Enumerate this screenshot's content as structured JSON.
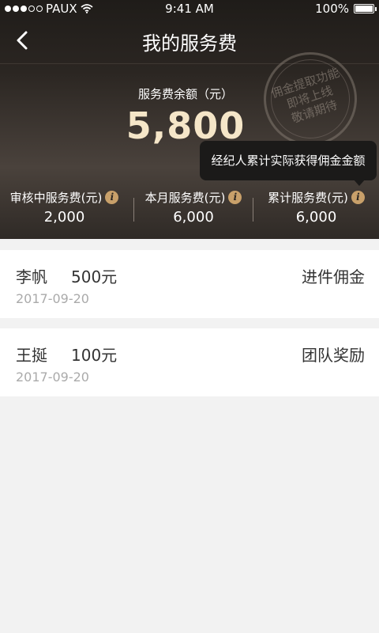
{
  "status_bar": {
    "carrier": "PAUX",
    "time": "9:41 AM",
    "battery": "100%",
    "battery_level": 1.0
  },
  "nav": {
    "title": "我的服务费",
    "back_icon": "chevron-left-icon"
  },
  "balance": {
    "label": "服务费余额（元）",
    "value": "5,800"
  },
  "stamp": {
    "line1": "佣金提取功能",
    "line2": "即将上线",
    "line3": "敬请期待"
  },
  "tooltip": {
    "text": "经纪人累计实际获得佣金金额"
  },
  "stats": [
    {
      "label": "审核中服务费(元)",
      "value": "2,000"
    },
    {
      "label": "本月服务费(元)",
      "value": "6,000"
    },
    {
      "label": "累计服务费(元)",
      "value": "6,000"
    }
  ],
  "records": [
    {
      "name": "李帆",
      "amount": "500元",
      "type": "进件佣金",
      "date": "2017-09-20"
    },
    {
      "name": "王挻",
      "amount": "100元",
      "type": "团队奖励",
      "date": "2017-09-20"
    }
  ],
  "colors": {
    "header_dark": "#2b2622",
    "accent_gold": "#c8a06a",
    "balance_text": "#f5e6c8",
    "page_bg": "#f2f2f2"
  }
}
